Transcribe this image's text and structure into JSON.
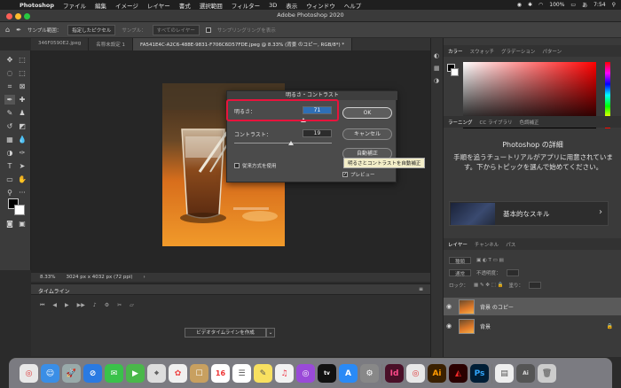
{
  "menubar": {
    "app_name": "Photoshop",
    "items": [
      "ファイル",
      "編集",
      "イメージ",
      "レイヤー",
      "書式",
      "選択範囲",
      "フィルター",
      "3D",
      "表示",
      "ウィンドウ",
      "ヘルプ"
    ],
    "battery": "100%",
    "time": "7:54"
  },
  "window": {
    "title": "Adobe Photoshop 2020"
  },
  "options_bar": {
    "sample_label": "サンプル範囲：",
    "sample_value": "指定したピクセル",
    "sample_label2": "サンプル：",
    "sample_value2": "すべてのレイヤー",
    "show_ring": "サンプリングリングを表示"
  },
  "tabs": [
    "346F0590E2.jpeg",
    "名称未設定 1",
    "FA541E4C-A2C6-488E-9831-F706C6D57FDE.jpeg @ 8.33% (背景 のコピー, RGB/8*) *"
  ],
  "statusbar": {
    "zoom": "8.33%",
    "doc_size": "3024 px x 4032 px (72 ppi)"
  },
  "timeline": {
    "title": "タイムライン",
    "create_button": "ビデオタイムラインを作成"
  },
  "color_panel": {
    "tabs": [
      "カラー",
      "スウォッチ",
      "グラデーション",
      "パターン"
    ]
  },
  "learn_panel": {
    "tabs": [
      "ラーニング",
      "CC ライブラリ",
      "色調補正"
    ],
    "heading": "Photoshop の詳細",
    "description": "手順を追うチュートリアルがアプリに用意されています。下からトピックを選んで始めてください。",
    "card_label": "基本的なスキル"
  },
  "layers_panel": {
    "tabs": [
      "レイヤー",
      "チャンネル",
      "パス"
    ],
    "kind_label": "種類",
    "mode_label": "通常",
    "opacity_label": "不透明度：",
    "lock_label": "ロック：",
    "fill_label": "塗り：",
    "layers": [
      {
        "name": "背景 のコピー",
        "selected": true
      },
      {
        "name": "背景",
        "selected": false
      }
    ]
  },
  "dialog": {
    "title": "明るさ・コントラスト",
    "brightness_label": "明るさ：",
    "brightness_value": "71",
    "contrast_label": "コントラスト：",
    "contrast_value": "19",
    "ok": "OK",
    "cancel": "キャンセル",
    "auto": "自動補正",
    "legacy": "従来方式を使用",
    "preview": "プレビュー",
    "tooltip": "明るさとコントラストを自動補正"
  },
  "colors": {
    "highlight": "#e8133c",
    "accent": "#2f6fb5"
  }
}
